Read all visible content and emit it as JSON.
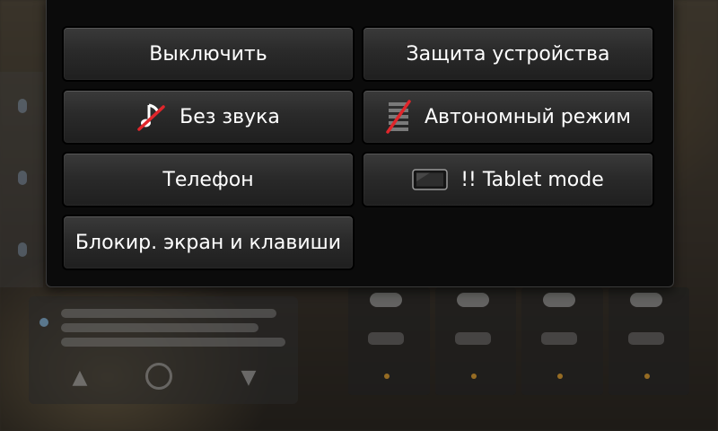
{
  "power_menu": {
    "buttons": [
      {
        "id": "power_off",
        "label": "Выключить"
      },
      {
        "id": "device_lock",
        "label": "Защита устройства"
      },
      {
        "id": "silent",
        "label": "Без звука",
        "icon": "silent-music-note-icon"
      },
      {
        "id": "offline",
        "label": "Автономный режим",
        "icon": "offline-mode-icon"
      },
      {
        "id": "phone",
        "label": "Телефон"
      },
      {
        "id": "tablet_mode",
        "label": "!! Tablet mode",
        "icon": "tablet-icon"
      },
      {
        "id": "lock_screen",
        "label": "Блокир. экран и клавиши"
      }
    ]
  },
  "colors": {
    "dialog_background": "#0b0b0b",
    "button_text": "#ffffff",
    "strike_red": "#e0262b"
  }
}
